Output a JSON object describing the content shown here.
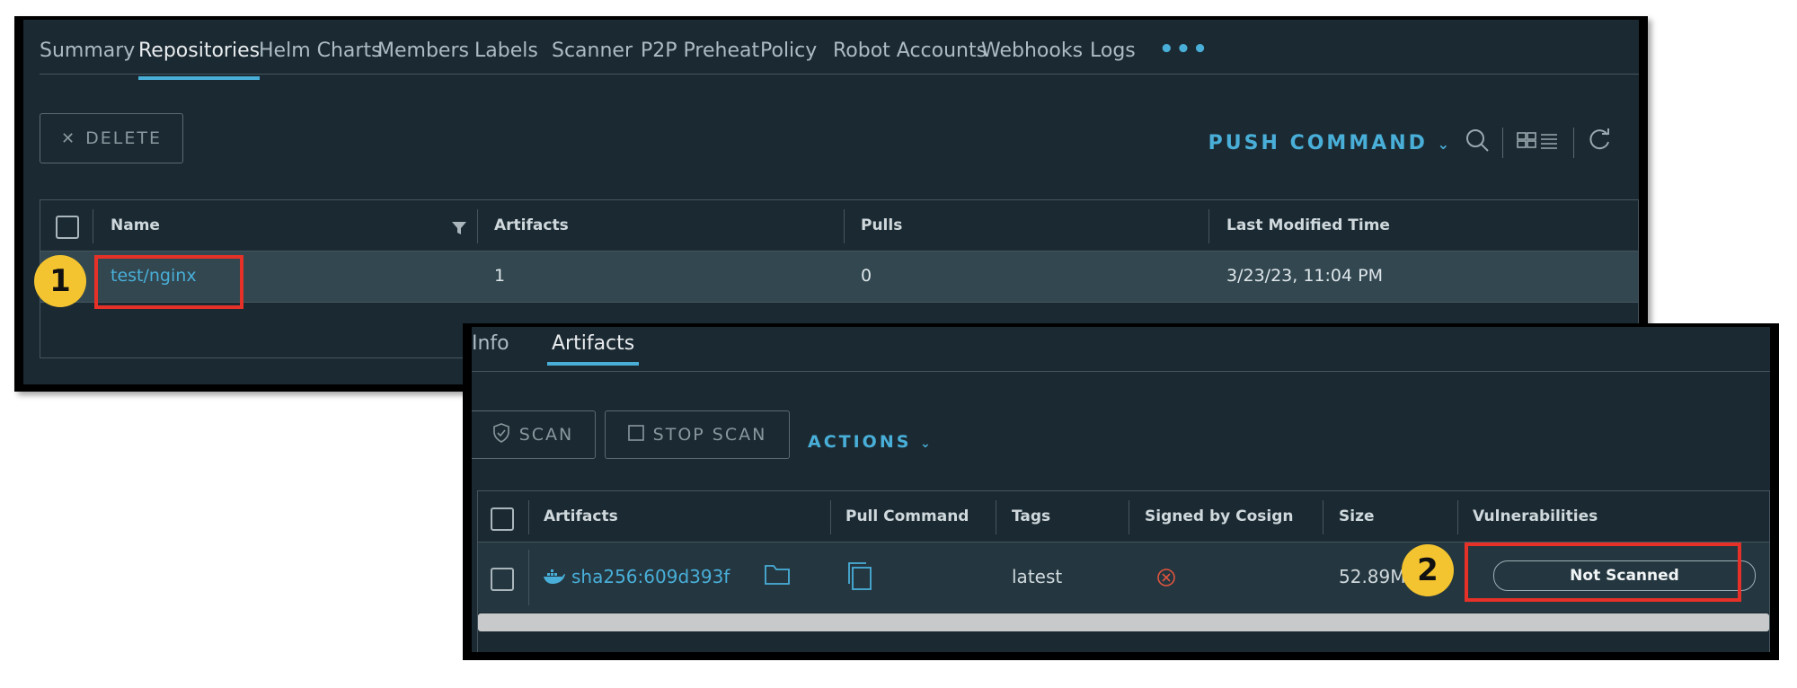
{
  "panel1": {
    "tabs": [
      {
        "label": "Summary"
      },
      {
        "label": "Repositories"
      },
      {
        "label": "Helm Charts"
      },
      {
        "label": "Members"
      },
      {
        "label": "Labels"
      },
      {
        "label": "Scanner"
      },
      {
        "label": "P2P Preheat"
      },
      {
        "label": "Policy"
      },
      {
        "label": "Robot Accounts"
      },
      {
        "label": "Webhooks"
      },
      {
        "label": "Logs"
      }
    ],
    "more": "•••",
    "delete_label": "DELETE",
    "push_command_label": "PUSH COMMAND",
    "table": {
      "headers": {
        "name": "Name",
        "artifacts": "Artifacts",
        "pulls": "Pulls",
        "modified": "Last Modified Time"
      },
      "row": {
        "name": "test/nginx",
        "artifacts": "1",
        "pulls": "0",
        "modified": "3/23/23, 11:04 PM"
      }
    }
  },
  "panel2": {
    "tabs": [
      {
        "label": "Info"
      },
      {
        "label": "Artifacts"
      }
    ],
    "scan_label": "SCAN",
    "stop_scan_label": "STOP SCAN",
    "actions_label": "ACTIONS",
    "table": {
      "headers": {
        "artifacts": "Artifacts",
        "pull_command": "Pull Command",
        "tags": "Tags",
        "signed": "Signed by Cosign",
        "size": "Size",
        "vulnerabilities": "Vulnerabilities"
      },
      "row": {
        "digest": "sha256:609d393f",
        "tags": "latest",
        "size": "52.89M",
        "vulnerabilities": "Not Scanned"
      }
    }
  },
  "annotations": {
    "badge1": "1",
    "badge2": "2"
  },
  "colors": {
    "accent": "#49afd9",
    "highlight": "#e53128",
    "badge": "#f4c430",
    "background": "#1b2a32"
  }
}
